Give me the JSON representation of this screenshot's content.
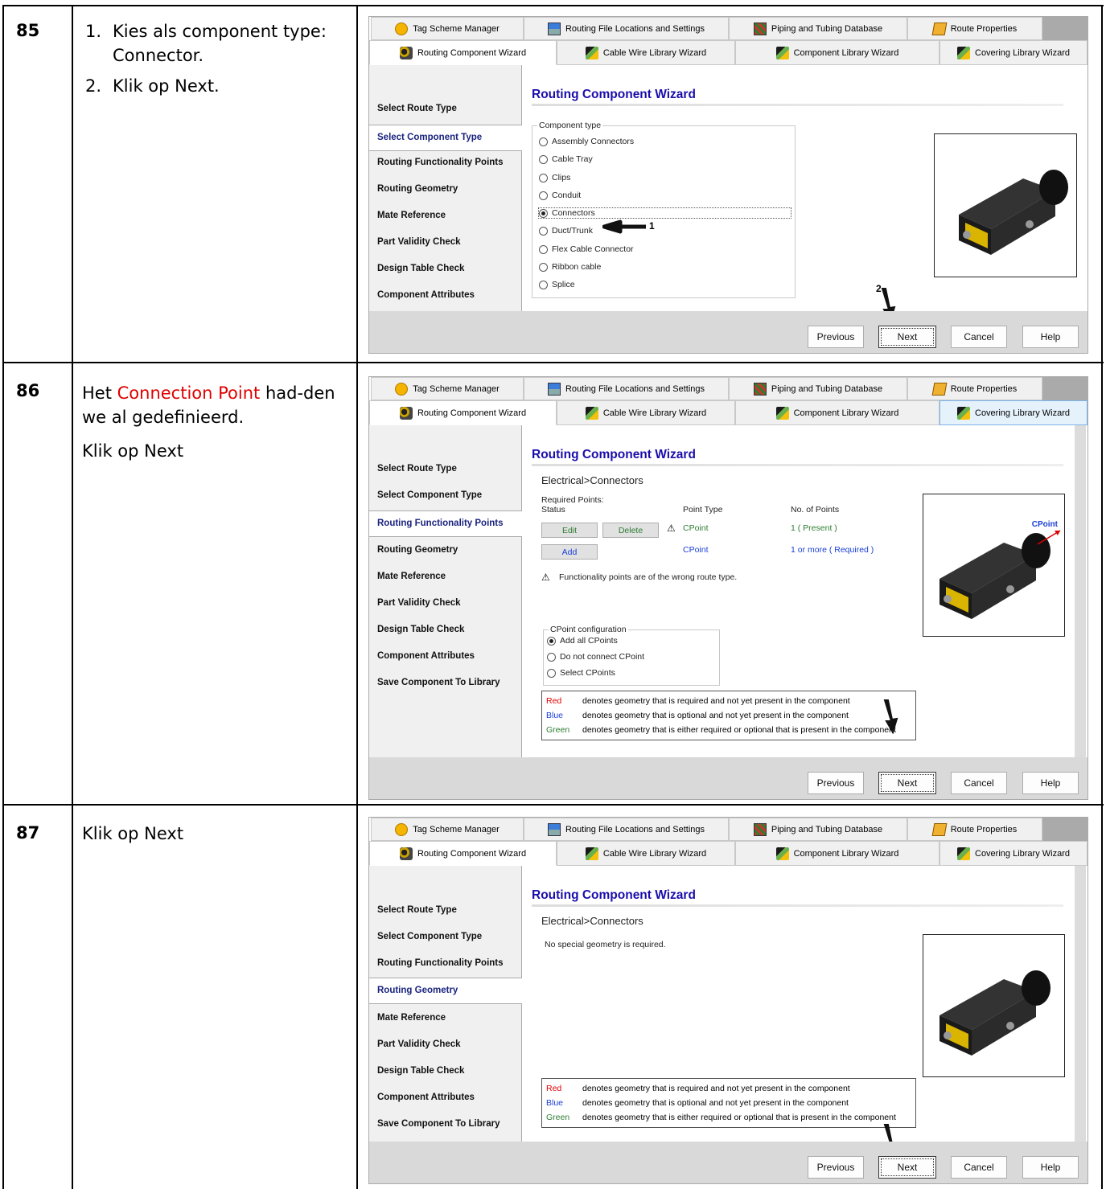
{
  "steps": [
    {
      "number": "85",
      "lines": [
        {
          "num": "1.",
          "text": "Kies als component type: Connector."
        },
        {
          "num": "2.",
          "text": "Klik op Next."
        }
      ],
      "callout_1": "1",
      "callout_2": "2"
    },
    {
      "number": "86",
      "highlight": "Connection Point",
      "text_before": "Het ",
      "text_after": " had-den we al gedefinieerd.",
      "line2": "Klik op Next"
    },
    {
      "number": "87",
      "text": "Klik op Next"
    }
  ],
  "tabs_row1": [
    "Tag Scheme Manager",
    "Routing File Locations and Settings",
    "Piping and Tubing Database",
    "Route Properties"
  ],
  "tabs_row2": [
    "Routing Component Wizard",
    "Cable Wire Library Wizard",
    "Component Library Wizard",
    "Covering Library Wizard"
  ],
  "wizard_title": "Routing Component Wizard",
  "nav_items_85": [
    "Select Route Type",
    "Select Component Type",
    "Routing Functionality Points",
    "Routing Geometry",
    "Mate Reference",
    "Part Validity Check",
    "Design Table Check",
    "Component Attributes"
  ],
  "nav_items": [
    "Select Route Type",
    "Select Component Type",
    "Routing Functionality Points",
    "Routing Geometry",
    "Mate Reference",
    "Part Validity Check",
    "Design Table Check",
    "Component Attributes",
    "Save Component To Library"
  ],
  "component_type": {
    "legend": "Component type",
    "options": [
      "Assembly Connectors",
      "Cable Tray",
      "Clips",
      "Conduit",
      "Connectors",
      "Duct/Trunk",
      "Flex Cable Connector",
      "Ribbon cable",
      "Splice"
    ],
    "selected": "Connectors"
  },
  "breadcrumb": "Electrical>Connectors",
  "required_points": {
    "label": "Required Points:",
    "col_status": "Status",
    "col_type": "Point Type",
    "col_count": "No. of Points",
    "btn_edit": "Edit",
    "btn_delete": "Delete",
    "btn_add": "Add",
    "row1_type": "CPoint",
    "row1_count": "1 ( Present )",
    "row2_type": "CPoint",
    "row2_count": "1 or more ( Required )",
    "warning": "Functionality points are of the wrong route type."
  },
  "cpoint_config": {
    "legend": "CPoint configuration",
    "options": [
      "Add all CPoints",
      "Do not connect CPoint",
      "Select CPoints"
    ],
    "selected": "Add all CPoints"
  },
  "image_label": "CPoint",
  "no_geometry": "No special geometry is required.",
  "color_legend": [
    {
      "key": "Red",
      "text": "denotes geometry that is required and not yet present in the component",
      "color": "#e00000"
    },
    {
      "key": "Blue",
      "text": "denotes geometry that is optional and not yet present in the component",
      "color": "#1a3fd6"
    },
    {
      "key": "Green",
      "text": "denotes geometry that is either required or optional that is present in the component",
      "color": "#2e7d32"
    }
  ],
  "buttons": {
    "previous": "Previous",
    "next": "Next",
    "cancel": "Cancel",
    "help": "Help"
  }
}
